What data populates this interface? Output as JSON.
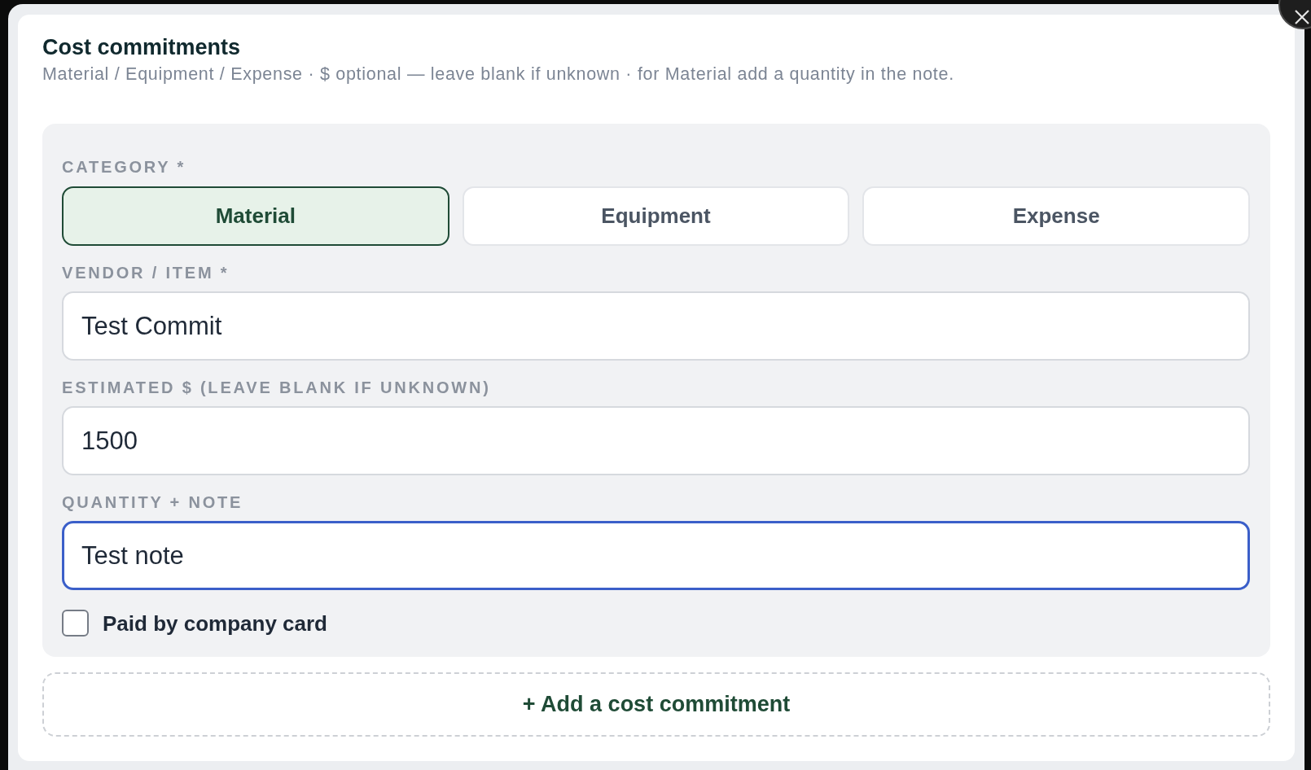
{
  "dialog": {
    "title": "Cost commitments",
    "subtitle": "Material / Equipment / Expense · $ optional — leave blank if unknown · for Material add a quantity in the note."
  },
  "form": {
    "category": {
      "label": "CATEGORY *",
      "options": [
        {
          "label": "Material",
          "selected": true
        },
        {
          "label": "Equipment",
          "selected": false
        },
        {
          "label": "Expense",
          "selected": false
        }
      ]
    },
    "fields": [
      {
        "label": "VENDOR / ITEM *",
        "value": "Test Commit",
        "focused": false
      },
      {
        "label": "ESTIMATED $ (LEAVE BLANK IF UNKNOWN)",
        "value": "1500",
        "focused": false
      },
      {
        "label": "QUANTITY + NOTE",
        "value": "Test note",
        "focused": true
      }
    ],
    "checkbox": {
      "label": "Paid by company card",
      "checked": false
    }
  },
  "add_button": {
    "label": "+ Add a cost commitment"
  }
}
